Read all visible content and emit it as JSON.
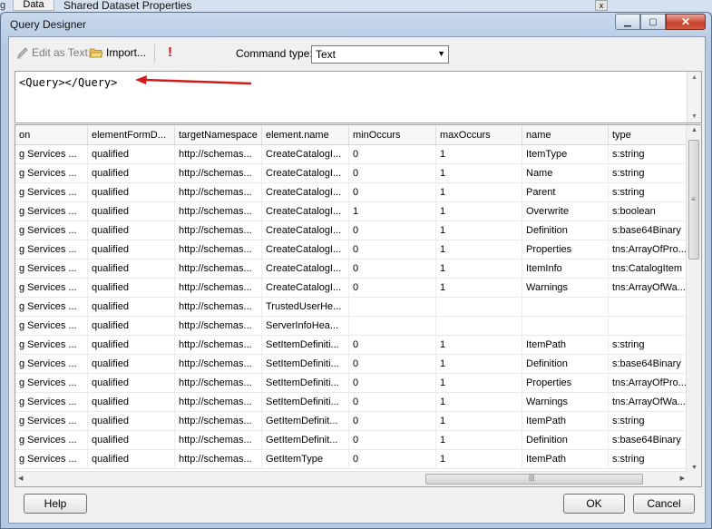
{
  "background": {
    "left_tab": "g",
    "data_tab": "Data",
    "title": "Shared Dataset Properties",
    "close_glyph": "x"
  },
  "dialog": {
    "title": "Query Designer",
    "controls": {
      "minimize": "▁",
      "maximize": "▢",
      "close": "✕"
    }
  },
  "toolbar": {
    "edit_as_text": "Edit as Text",
    "import": "Import...",
    "run": "!",
    "command_type_label": "Command type:",
    "command_type_value": "Text"
  },
  "query": {
    "text": "<Query></Query>"
  },
  "grid": {
    "columns": [
      "on",
      "elementFormD...",
      "targetNamespace",
      "element.name",
      "minOccurs",
      "maxOccurs",
      "name",
      "type"
    ],
    "rows": [
      [
        "g Services ...",
        "qualified",
        "http://schemas...",
        "CreateCatalogI...",
        "0",
        "1",
        "ItemType",
        "s:string"
      ],
      [
        "g Services ...",
        "qualified",
        "http://schemas...",
        "CreateCatalogI...",
        "0",
        "1",
        "Name",
        "s:string"
      ],
      [
        "g Services ...",
        "qualified",
        "http://schemas...",
        "CreateCatalogI...",
        "0",
        "1",
        "Parent",
        "s:string"
      ],
      [
        "g Services ...",
        "qualified",
        "http://schemas...",
        "CreateCatalogI...",
        "1",
        "1",
        "Overwrite",
        "s:boolean"
      ],
      [
        "g Services ...",
        "qualified",
        "http://schemas...",
        "CreateCatalogI...",
        "0",
        "1",
        "Definition",
        "s:base64Binary"
      ],
      [
        "g Services ...",
        "qualified",
        "http://schemas...",
        "CreateCatalogI...",
        "0",
        "1",
        "Properties",
        "tns:ArrayOfPro..."
      ],
      [
        "g Services ...",
        "qualified",
        "http://schemas...",
        "CreateCatalogI...",
        "0",
        "1",
        "ItemInfo",
        "tns:CatalogItem"
      ],
      [
        "g Services ...",
        "qualified",
        "http://schemas...",
        "CreateCatalogI...",
        "0",
        "1",
        "Warnings",
        "tns:ArrayOfWa..."
      ],
      [
        "g Services ...",
        "qualified",
        "http://schemas...",
        "TrustedUserHe...",
        "",
        "",
        "",
        ""
      ],
      [
        "g Services ...",
        "qualified",
        "http://schemas...",
        "ServerInfoHea...",
        "",
        "",
        "",
        ""
      ],
      [
        "g Services ...",
        "qualified",
        "http://schemas...",
        "SetItemDefiniti...",
        "0",
        "1",
        "ItemPath",
        "s:string"
      ],
      [
        "g Services ...",
        "qualified",
        "http://schemas...",
        "SetItemDefiniti...",
        "0",
        "1",
        "Definition",
        "s:base64Binary"
      ],
      [
        "g Services ...",
        "qualified",
        "http://schemas...",
        "SetItemDefiniti...",
        "0",
        "1",
        "Properties",
        "tns:ArrayOfPro..."
      ],
      [
        "g Services ...",
        "qualified",
        "http://schemas...",
        "SetItemDefiniti...",
        "0",
        "1",
        "Warnings",
        "tns:ArrayOfWa..."
      ],
      [
        "g Services ...",
        "qualified",
        "http://schemas...",
        "GetItemDefinit...",
        "0",
        "1",
        "ItemPath",
        "s:string"
      ],
      [
        "g Services ...",
        "qualified",
        "http://schemas...",
        "GetItemDefinit...",
        "0",
        "1",
        "Definition",
        "s:base64Binary"
      ],
      [
        "g Services ...",
        "qualified",
        "http://schemas...",
        "GetItemType",
        "0",
        "1",
        "ItemPath",
        "s:string"
      ]
    ]
  },
  "buttons": {
    "help": "Help",
    "ok": "OK",
    "cancel": "Cancel"
  },
  "colors": {
    "arrow": "#d11b1b",
    "run_icon": "#cc1111"
  }
}
